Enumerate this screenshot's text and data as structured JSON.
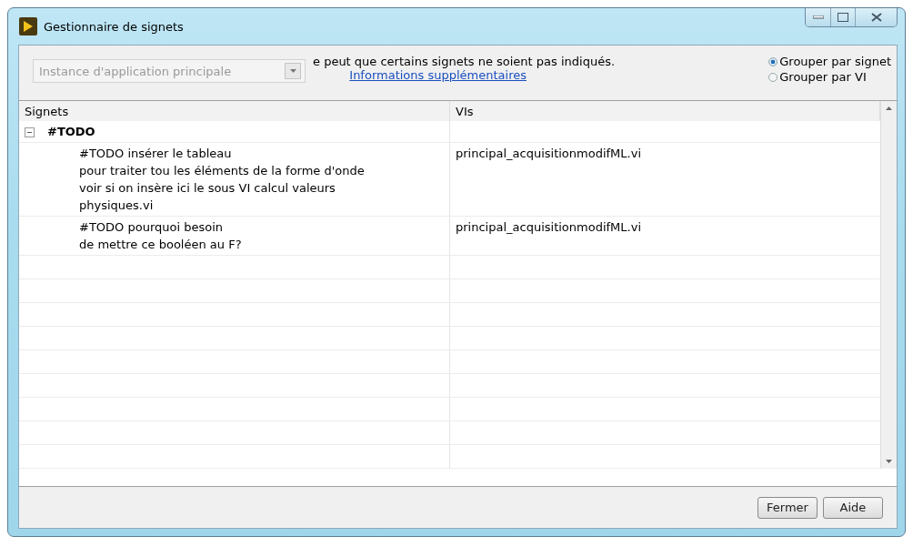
{
  "window": {
    "title": "Gestionnaire de signets"
  },
  "instance_dropdown": {
    "value": "Instance d'application principale",
    "disabled": true
  },
  "notice": {
    "text": "e peut que certains signets ne soient pas indiqués.",
    "link": "Informations supplémentaires"
  },
  "grouping": [
    {
      "label": "Grouper par signet",
      "selected": true
    },
    {
      "label": "Grouper par VI",
      "selected": false
    }
  ],
  "table": {
    "columns": [
      "Signets",
      "VIs"
    ],
    "groups": [
      {
        "label": "#TODO",
        "expanded": true,
        "children": [
          {
            "bookmark": "#TODO insérer le tableau\npour traiter tou les éléments de la forme d'onde\nvoir si on insère ici le sous VI calcul valeurs\nphysiques.vi",
            "vi": "principal_acquisitionmodifML.vi"
          },
          {
            "bookmark": "#TODO pourquoi besoin\nde mettre ce booléen au F?",
            "vi": "principal_acquisitionmodifML.vi"
          }
        ]
      }
    ]
  },
  "buttons": [
    "Fermer",
    "Aide"
  ]
}
